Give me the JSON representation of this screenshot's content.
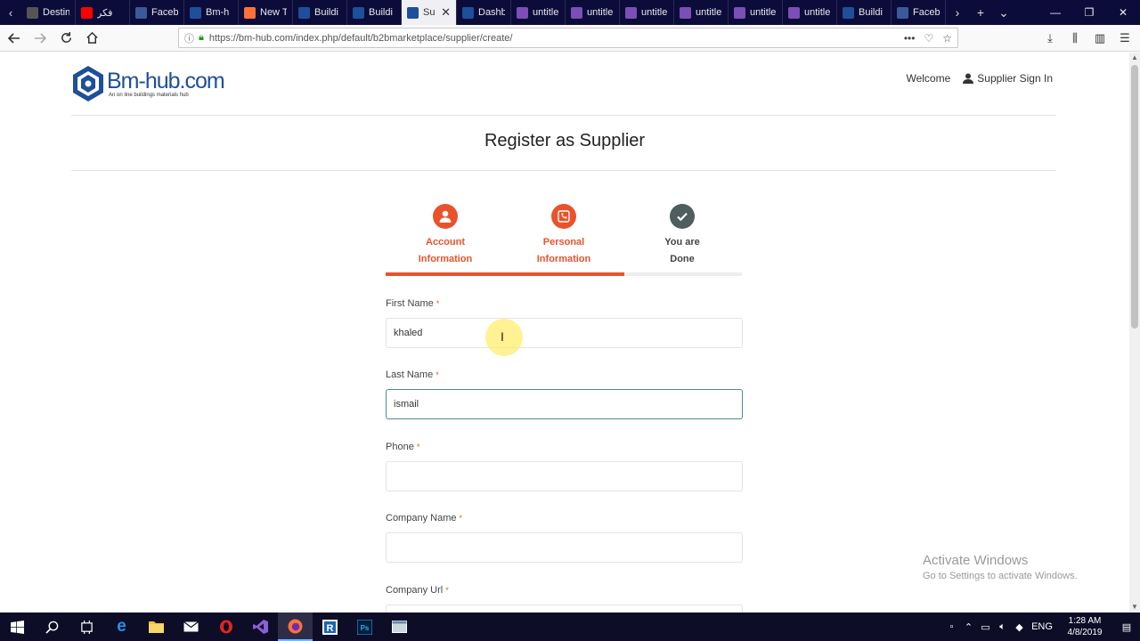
{
  "browser": {
    "tabs": [
      {
        "label": "Destin",
        "icon": "page-icon",
        "color": "#555555"
      },
      {
        "label": "فكر",
        "icon": "youtube-icon",
        "color": "#ff0000"
      },
      {
        "label": "Faceb",
        "icon": "facebook-icon",
        "color": "#3b5998"
      },
      {
        "label": "Bm-h",
        "icon": "bmhub-icon",
        "color": "#1d4f9a"
      },
      {
        "label": "New T",
        "icon": "firefox-icon",
        "color": "#ff7139"
      },
      {
        "label": "Buildi",
        "icon": "bmhub-icon",
        "color": "#1d4f9a"
      },
      {
        "label": "Buildi",
        "icon": "bmhub-icon",
        "color": "#1d4f9a"
      },
      {
        "label": "Su",
        "icon": "bmhub-icon",
        "color": "#1d4f9a",
        "active": true
      },
      {
        "label": "Dashb",
        "icon": "bmhub-icon",
        "color": "#1d4f9a"
      },
      {
        "label": "untitle",
        "icon": "figma-icon",
        "color": "#7b4fb5"
      },
      {
        "label": "untitle",
        "icon": "figma-icon",
        "color": "#7b4fb5"
      },
      {
        "label": "untitle",
        "icon": "figma-icon",
        "color": "#7b4fb5"
      },
      {
        "label": "untitle",
        "icon": "figma-icon",
        "color": "#7b4fb5"
      },
      {
        "label": "untitle",
        "icon": "figma-icon",
        "color": "#7b4fb5"
      },
      {
        "label": "untitle",
        "icon": "figma-icon",
        "color": "#7b4fb5"
      },
      {
        "label": "Buildi",
        "icon": "bmhub-icon",
        "color": "#1d4f9a"
      },
      {
        "label": "Faceb",
        "icon": "facebook-icon",
        "color": "#3b5998"
      }
    ],
    "url": "https://bm-hub.com/index.php/default/b2bmarketplace/supplier/create/"
  },
  "site": {
    "logo_name": "Bm-hub.com",
    "logo_tagline": "An on line buildings materials hub",
    "welcome": "Welcome",
    "sign_in": "Supplier Sign In"
  },
  "page": {
    "title": "Register as Supplier",
    "steps": [
      {
        "line1": "Account",
        "line2": "Information",
        "state": "done",
        "icon": "user-icon"
      },
      {
        "line1": "Personal",
        "line2": "Information",
        "state": "current",
        "icon": "phone-icon"
      },
      {
        "line1": "You are",
        "line2": "Done",
        "state": "pending",
        "icon": "checkmark-icon"
      }
    ],
    "progress_percent": 67,
    "required_mark": "*",
    "fields": {
      "first_name": {
        "label": "First Name",
        "value": "khaled"
      },
      "last_name": {
        "label": "Last Name",
        "value": "ismail"
      },
      "phone": {
        "label": "Phone",
        "value": ""
      },
      "company_name": {
        "label": "Company Name",
        "value": ""
      },
      "company_url": {
        "label": "Company Url",
        "value": ""
      }
    }
  },
  "watermark": {
    "line1": "Activate Windows",
    "line2": "Go to Settings to activate Windows."
  },
  "taskbar": {
    "lang": "ENG",
    "time": "1:28 AM",
    "date": "4/8/2019"
  },
  "colors": {
    "accent": "#e8532c",
    "done_step": "#4e5d5e",
    "focus_border": "#4b8c95",
    "brand": "#1d4f9a"
  }
}
